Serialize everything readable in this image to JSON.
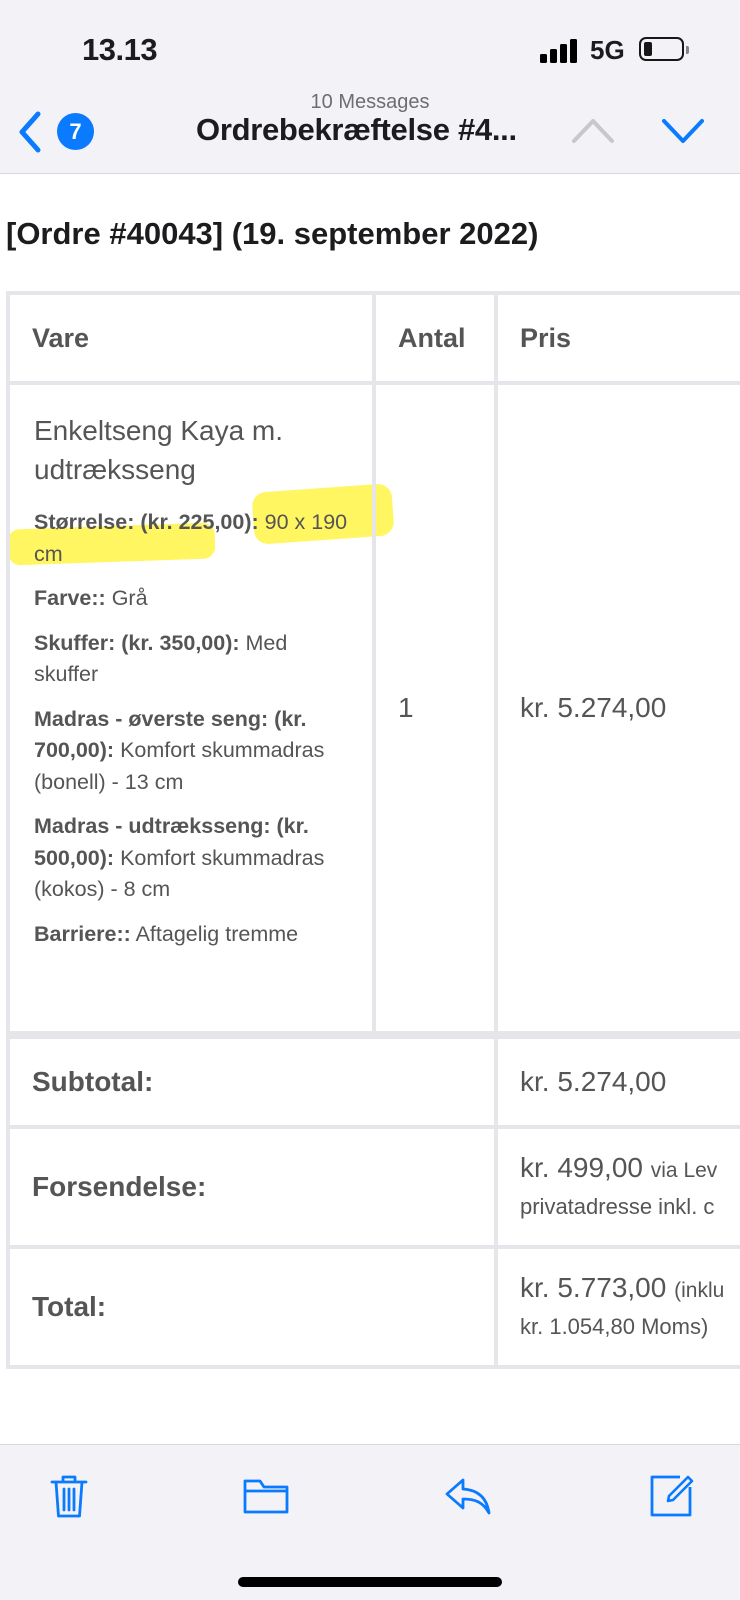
{
  "status_bar": {
    "time": "13.13",
    "network": "5G"
  },
  "nav": {
    "unread_badge": "7",
    "message_count": "10 Messages",
    "subject": "Ordrebekræftelse #4..."
  },
  "email": {
    "order_heading": "[Ordre #40043] (19. september 2022)",
    "table": {
      "headers": {
        "item": "Vare",
        "qty": "Antal",
        "price": "Pris"
      },
      "item": {
        "product": "Enkeltseng Kaya m. udtræksseng",
        "attributes": [
          {
            "label": "Størrelse: (kr. 225,00):",
            "value": "90 x 190 cm"
          },
          {
            "label": "Farve::",
            "value": "Grå"
          },
          {
            "label": "Skuffer: (kr. 350,00):",
            "value": "Med skuffer"
          },
          {
            "label": "Madras - øverste seng: (kr. 700,00):",
            "value": "Komfort skummadras (bonell) - 13 cm"
          },
          {
            "label": "Madras - udtræksseng: (kr. 500,00):",
            "value": "Komfort skummadras (kokos) - 8 cm"
          },
          {
            "label": "Barriere::",
            "value": "Aftagelig tremme"
          }
        ],
        "quantity": "1",
        "price": "kr. 5.274,00"
      },
      "totals": {
        "subtotal_label": "Subtotal:",
        "subtotal_value": "kr. 5.274,00",
        "shipping_label": "Forsendelse:",
        "shipping_value": "kr. 499,00",
        "shipping_via": "via Lev",
        "shipping_line2": "privatadresse inkl. c",
        "total_label": "Total:",
        "total_value": "kr. 5.773,00",
        "total_note": "(inklu",
        "total_line2": "kr. 1.054,80 Moms)"
      }
    }
  },
  "toolbar": {
    "icons": [
      "trash-icon",
      "folder-icon",
      "reply-icon",
      "compose-icon"
    ]
  },
  "colors": {
    "accent": "#0a7aff",
    "highlight": "#fff000",
    "toolbar_bg": "#f2f2f7"
  }
}
